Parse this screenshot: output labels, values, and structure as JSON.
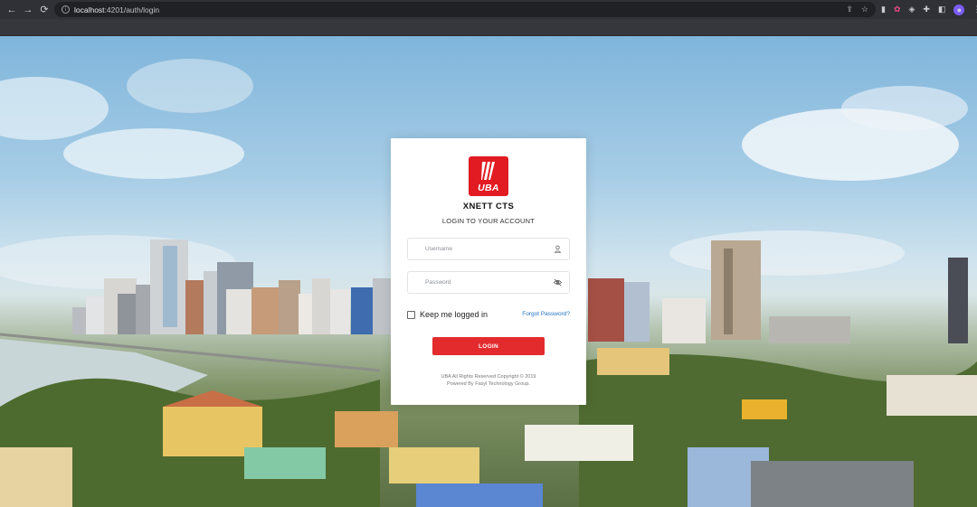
{
  "browser": {
    "url_host": "localhost",
    "url_rest": ":4201/auth/login",
    "back_icon": "←",
    "forward_icon": "→",
    "reload_icon": "⟳",
    "profile_initial": "◉"
  },
  "login": {
    "logo_text": "UBA",
    "app_name": "XNETT CTS",
    "subtitle": "LOGIN TO YOUR ACCOUNT",
    "username_placeholder": "Username",
    "password_placeholder": "Password",
    "remember_label": "Keep me logged in",
    "forgot_label": "Forgot Password?",
    "login_button": "LOGIN",
    "footer_line1": "UBA All Rights Reserved Copyright © 2019",
    "footer_line2": "Powered By Fasyl Technology Group."
  },
  "colors": {
    "brand_red": "#e21b22",
    "button_red": "#e32b2e",
    "link_blue": "#2474c4"
  }
}
